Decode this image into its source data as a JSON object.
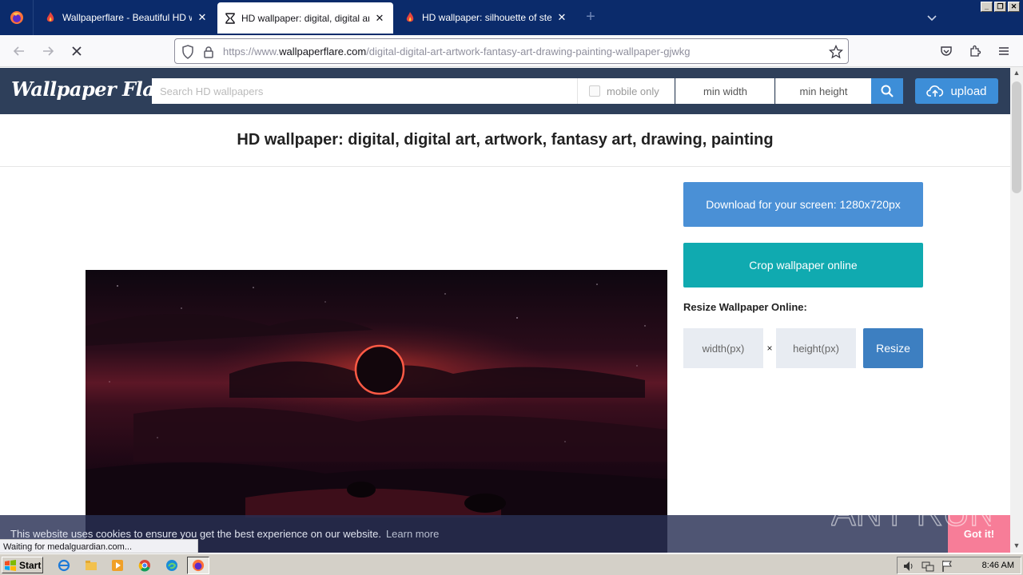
{
  "browser": {
    "tabs": [
      {
        "label": "Wallpaperflare - Beautiful HD wallp"
      },
      {
        "label": "HD wallpaper: digital, digital art, ar"
      },
      {
        "label": "HD wallpaper: silhouette of steel ri"
      }
    ],
    "new_tab_label": "+",
    "url_prefix": "https://www.",
    "url_host": "wallpaperflare.com",
    "url_path": "/digital-digital-art-artwork-fantasy-art-drawing-painting-wallpaper-gjwkg"
  },
  "site": {
    "logo": "Wallpaper Flare",
    "search_placeholder": "Search HD wallpapers",
    "mobile_only": "mobile only",
    "min_width": "min width",
    "min_height": "min height",
    "upload": "upload"
  },
  "page": {
    "title": "HD wallpaper: digital, digital art, artwork, fantasy art, drawing, painting",
    "download_button": "Download for your screen: 1280x720px",
    "crop_button": "Crop wallpaper online",
    "resize_label": "Resize Wallpaper Online:",
    "width_placeholder": "width(px)",
    "times": "×",
    "height_placeholder": "height(px)",
    "resize_button": "Resize"
  },
  "cookie": {
    "text": "This website uses cookies to ensure you get the best experience on our website.",
    "learn_more": "Learn more",
    "got_it": "Got it!"
  },
  "status_text": "Waiting for medalguardian.com...",
  "taskbar": {
    "start": "Start",
    "clock": "8:46 AM"
  },
  "watermark": "ANY RUN",
  "colors": {
    "tabstrip": "#0b2b6b",
    "site_header": "#2e3f5a",
    "download": "#4a90d6",
    "crop": "#10aab0",
    "resize": "#3d7fc1",
    "got_it": "#f77d98"
  }
}
